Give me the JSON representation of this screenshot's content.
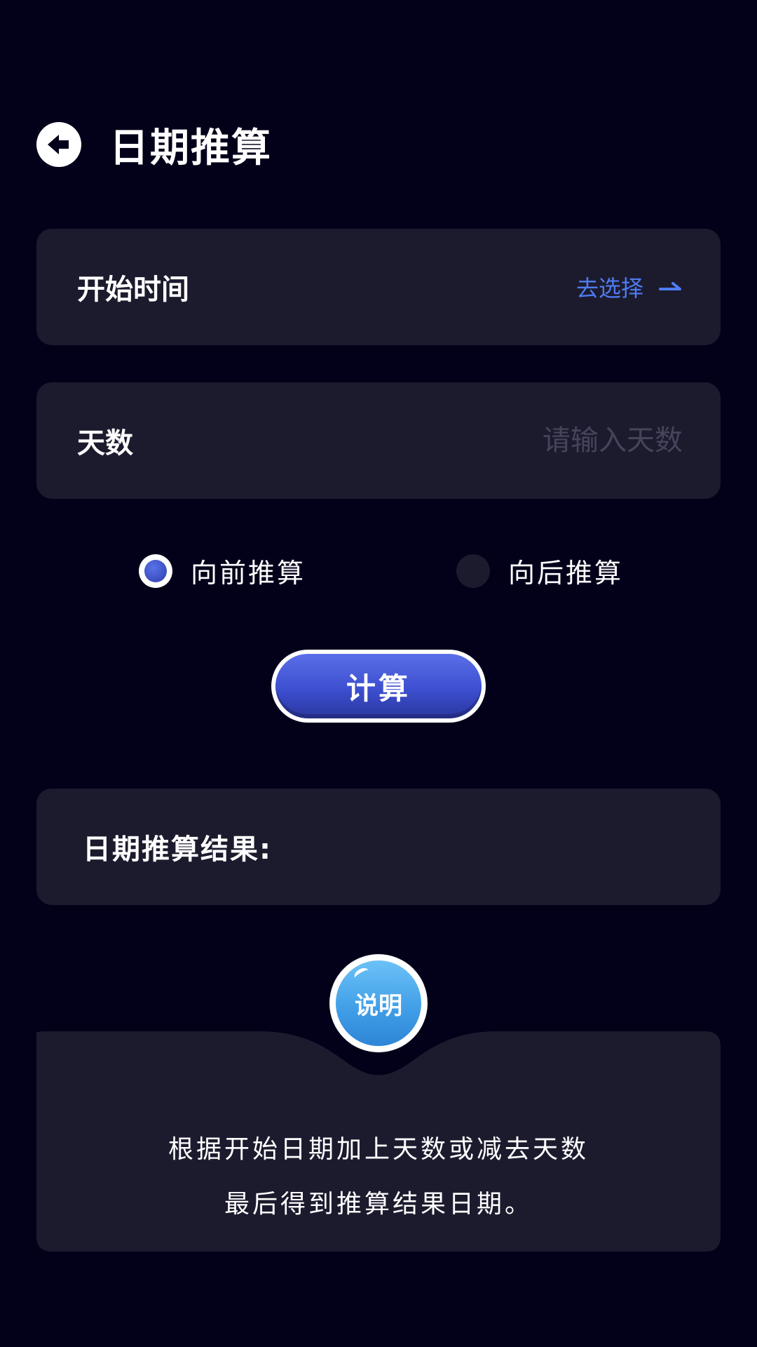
{
  "header": {
    "title": "日期推算",
    "back_icon": "arrow-left-circle-icon"
  },
  "start_time": {
    "label": "开始时间",
    "action_label": "去选择",
    "action_icon": "arrow-right-icon"
  },
  "days": {
    "label": "天数",
    "value": "",
    "placeholder": "请输入天数"
  },
  "direction": {
    "options": [
      {
        "label": "向前推算",
        "checked": true
      },
      {
        "label": "向后推算",
        "checked": false
      }
    ]
  },
  "calculate_button": {
    "label": "计算"
  },
  "result": {
    "label": "日期推算结果:"
  },
  "explanation": {
    "badge_label": "说明",
    "lines": [
      "根据开始日期加上天数或减去天数",
      "最后得到推算结果日期。"
    ]
  },
  "colors": {
    "background": "#03001a",
    "card": "#1c1b2e",
    "accent": "#4e7cf2",
    "button": "#3d4fd0",
    "badge": "#3f9ce6"
  }
}
